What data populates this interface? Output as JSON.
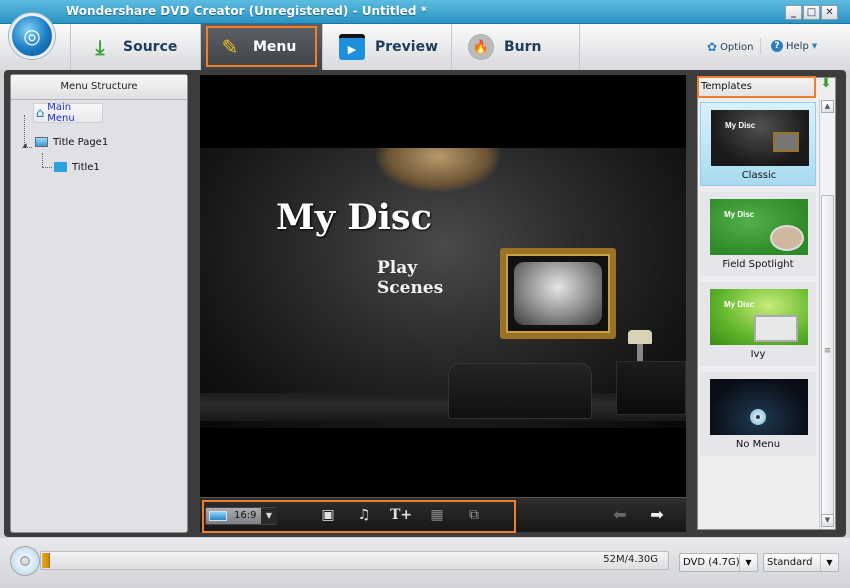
{
  "window": {
    "title": "Wondershare DVD Creator (Unregistered) - Untitled *",
    "controls": {
      "minimize": "_",
      "maximize": "□",
      "close": "✕"
    }
  },
  "toolbar": {
    "tabs": [
      {
        "label": "Source",
        "icon": "download-arrow-icon",
        "active": false
      },
      {
        "label": "Menu",
        "icon": "pencil-ruler-icon",
        "active": true
      },
      {
        "label": "Preview",
        "icon": "clapperboard-icon",
        "active": false
      },
      {
        "label": "Burn",
        "icon": "disc-flame-icon",
        "active": false
      }
    ],
    "option_label": "Option",
    "help_label": "Help"
  },
  "menu_structure": {
    "header": "Menu Structure",
    "items": [
      {
        "label": "Main Menu",
        "icon": "home-icon",
        "level": 0,
        "selected": true
      },
      {
        "label": "Title Page1",
        "icon": "monitor-icon",
        "level": 1,
        "selected": false
      },
      {
        "label": "Title1",
        "icon": "folder-icon",
        "level": 2,
        "selected": false
      }
    ]
  },
  "preview": {
    "disc_title": "My Disc",
    "buttons": [
      "Play",
      "Scenes"
    ],
    "aspect_ratio": "16:9"
  },
  "templates": {
    "header": "Templates",
    "items": [
      {
        "label": "Classic",
        "selected": true,
        "thumb_title": "My Disc"
      },
      {
        "label": "Field Spotlight",
        "selected": false,
        "thumb_title": "My Disc"
      },
      {
        "label": "Ivy",
        "selected": false,
        "thumb_title": "My Disc"
      },
      {
        "label": "No Menu",
        "selected": false,
        "thumb_title": ""
      }
    ]
  },
  "status": {
    "capacity_text": "52M/4.30G",
    "capacity_used_fraction": 0.012,
    "disc_type": "DVD (4.7G)",
    "quality": "Standard"
  },
  "colors": {
    "accent_highlight": "#f07f2a",
    "titlebar": "#2a93c4",
    "progress_fill": "#e8a820"
  }
}
